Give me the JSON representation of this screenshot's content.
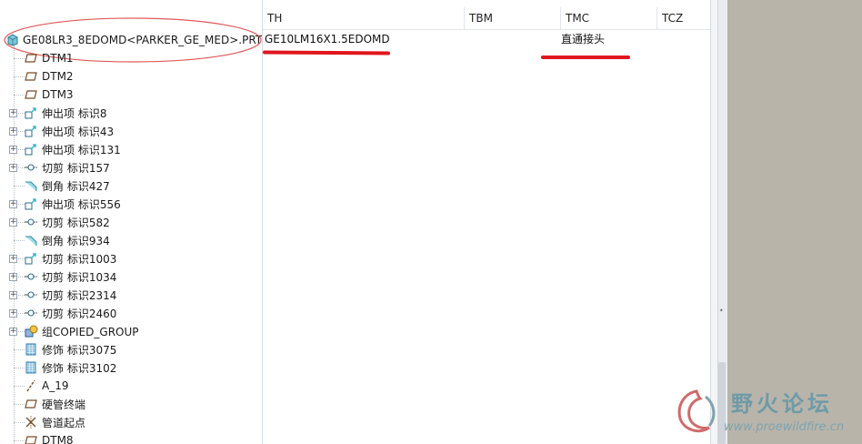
{
  "tree": {
    "items": [
      {
        "label": "GE08LR3_8EDOMD<PARKER_GE_MED>.PRT",
        "icon": "part-icon"
      },
      {
        "label": "DTM1",
        "icon": "datum-plane-icon"
      },
      {
        "label": "DTM2",
        "icon": "datum-plane-icon"
      },
      {
        "label": "DTM3",
        "icon": "datum-plane-icon"
      },
      {
        "label": "伸出项 标识8",
        "icon": "protrusion-icon"
      },
      {
        "label": "伸出项 标识43",
        "icon": "protrusion-icon"
      },
      {
        "label": "伸出项 标识131",
        "icon": "protrusion-icon"
      },
      {
        "label": "切剪 标识157",
        "icon": "cut-icon"
      },
      {
        "label": "倒角 标识427",
        "icon": "chamfer-icon"
      },
      {
        "label": "伸出项 标识556",
        "icon": "protrusion-icon"
      },
      {
        "label": "切剪 标识582",
        "icon": "cut-icon"
      },
      {
        "label": "倒角 标识934",
        "icon": "chamfer-icon"
      },
      {
        "label": "切剪 标识1003",
        "icon": "protrusion-icon"
      },
      {
        "label": "切剪 标识1034",
        "icon": "cut-icon"
      },
      {
        "label": "切剪 标识2314",
        "icon": "cut-icon"
      },
      {
        "label": "切剪 标识2460",
        "icon": "cut-icon"
      },
      {
        "label": "组COPIED_GROUP",
        "icon": "group-icon"
      },
      {
        "label": "修饰 标识3075",
        "icon": "cosmetic-icon"
      },
      {
        "label": "修饰 标识3102",
        "icon": "cosmetic-icon"
      },
      {
        "label": "A_19",
        "icon": "axis-icon"
      },
      {
        "label": "硬管终端",
        "icon": "datum-plane-icon"
      },
      {
        "label": "管道起点",
        "icon": "datum-point-icon"
      },
      {
        "label": "DTM8",
        "icon": "datum-plane-icon"
      }
    ]
  },
  "grid": {
    "columns": [
      "TH",
      "TBM",
      "TMC",
      "TCZ"
    ],
    "row": {
      "TH": "GE10LM16X1.5EDOMD",
      "TBM": "",
      "TMC": "直通接头",
      "TCZ": ""
    }
  },
  "watermark": {
    "title": "野火论坛",
    "url": "www.proewildfire.cn"
  },
  "colors": {
    "annotation_red": "#e0161c",
    "side_pane": "#b9b4aa"
  }
}
